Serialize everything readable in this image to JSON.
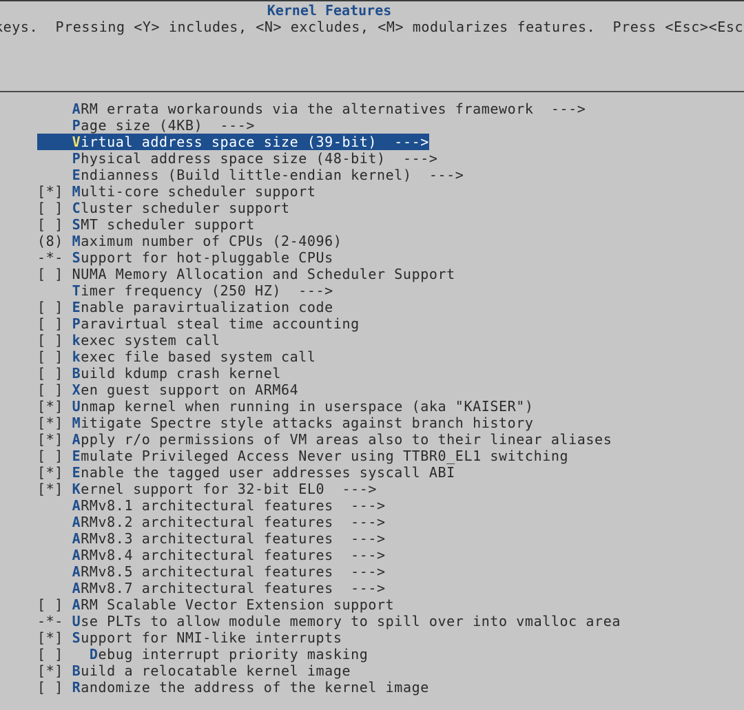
{
  "window": {
    "title": "Kernel Features",
    "help_text": "keys.  Pressing <Y> includes, <N> excludes, <M> modularizes features.  Press <Esc><Esc> to"
  },
  "menu": {
    "items": [
      {
        "prefix": "    ",
        "hotkey": "A",
        "label": "RM errata workarounds via the alternatives framework  --->",
        "selected": false
      },
      {
        "prefix": "    ",
        "hotkey": "P",
        "label": "age size (4KB)  --->",
        "selected": false
      },
      {
        "prefix": "    ",
        "hotkey": "V",
        "label": "irtual address space size (39-bit)  --->",
        "selected": true
      },
      {
        "prefix": "    ",
        "hotkey": "P",
        "label": "hysical address space size (48-bit)  --->",
        "selected": false
      },
      {
        "prefix": "    ",
        "hotkey": "E",
        "label": "ndianness (Build little-endian kernel)  --->",
        "selected": false
      },
      {
        "prefix": "[*] ",
        "hotkey": "M",
        "label": "ulti-core scheduler support",
        "selected": false
      },
      {
        "prefix": "[ ] ",
        "hotkey": "C",
        "label": "luster scheduler support",
        "selected": false
      },
      {
        "prefix": "[ ] ",
        "hotkey": "S",
        "label": "MT scheduler support",
        "selected": false
      },
      {
        "prefix": "(8) ",
        "hotkey": "M",
        "label": "aximum number of CPUs (2-4096)",
        "selected": false
      },
      {
        "prefix": "-*- ",
        "hotkey": "S",
        "label": "upport for hot-pluggable CPUs",
        "selected": false
      },
      {
        "prefix": "[ ] ",
        "hotkey": "",
        "label": "NUMA Memory Allocation and Scheduler Support",
        "selected": false
      },
      {
        "prefix": "    ",
        "hotkey": "T",
        "label": "imer frequency (250 HZ)  --->",
        "selected": false
      },
      {
        "prefix": "[ ] ",
        "hotkey": "E",
        "label": "nable paravirtualization code",
        "selected": false
      },
      {
        "prefix": "[ ] ",
        "hotkey": "P",
        "label": "aravirtual steal time accounting",
        "selected": false
      },
      {
        "prefix": "[ ] ",
        "hotkey": "k",
        "label": "exec system call",
        "selected": false
      },
      {
        "prefix": "[ ] ",
        "hotkey": "k",
        "label": "exec file based system call",
        "selected": false
      },
      {
        "prefix": "[ ] ",
        "hotkey": "B",
        "label": "uild kdump crash kernel",
        "selected": false
      },
      {
        "prefix": "[ ] ",
        "hotkey": "X",
        "label": "en guest support on ARM64",
        "selected": false
      },
      {
        "prefix": "[*] ",
        "hotkey": "U",
        "label": "nmap kernel when running in userspace (aka \"KAISER\")",
        "selected": false
      },
      {
        "prefix": "[*] ",
        "hotkey": "M",
        "label": "itigate Spectre style attacks against branch history",
        "selected": false
      },
      {
        "prefix": "[*] ",
        "hotkey": "A",
        "label": "pply r/o permissions of VM areas also to their linear aliases",
        "selected": false
      },
      {
        "prefix": "[ ] ",
        "hotkey": "E",
        "label": "mulate Privileged Access Never using TTBR0_EL1 switching",
        "selected": false
      },
      {
        "prefix": "[*] ",
        "hotkey": "E",
        "label": "nable the tagged user addresses syscall ABI",
        "selected": false
      },
      {
        "prefix": "[*] ",
        "hotkey": "K",
        "label": "ernel support for 32-bit EL0  --->",
        "selected": false
      },
      {
        "prefix": "    ",
        "hotkey": "A",
        "label": "RMv8.1 architectural features  --->",
        "selected": false
      },
      {
        "prefix": "    ",
        "hotkey": "A",
        "label": "RMv8.2 architectural features  --->",
        "selected": false
      },
      {
        "prefix": "    ",
        "hotkey": "A",
        "label": "RMv8.3 architectural features  --->",
        "selected": false
      },
      {
        "prefix": "    ",
        "hotkey": "A",
        "label": "RMv8.4 architectural features  --->",
        "selected": false
      },
      {
        "prefix": "    ",
        "hotkey": "A",
        "label": "RMv8.5 architectural features  --->",
        "selected": false
      },
      {
        "prefix": "    ",
        "hotkey": "A",
        "label": "RMv8.7 architectural features  --->",
        "selected": false
      },
      {
        "prefix": "[ ] ",
        "hotkey": "A",
        "label": "RM Scalable Vector Extension support",
        "selected": false
      },
      {
        "prefix": "-*- ",
        "hotkey": "U",
        "label": "se PLTs to allow module memory to spill over into vmalloc area",
        "selected": false
      },
      {
        "prefix": "[*] ",
        "hotkey": "S",
        "label": "upport for NMI-like interrupts",
        "selected": false
      },
      {
        "prefix": "[ ]   ",
        "hotkey": "D",
        "label": "ebug interrupt priority masking",
        "selected": false
      },
      {
        "prefix": "[*] ",
        "hotkey": "B",
        "label": "uild a relocatable kernel image",
        "selected": false
      },
      {
        "prefix": "[ ] ",
        "hotkey": "R",
        "label": "andomize the address of the kernel image",
        "selected": false
      }
    ]
  },
  "colors": {
    "background": "#c6c6c6",
    "text": "#2b2b2b",
    "hotkey": "#1f4e8c",
    "selection_bg": "#1d4f8f",
    "selection_text": "#ffffff"
  }
}
